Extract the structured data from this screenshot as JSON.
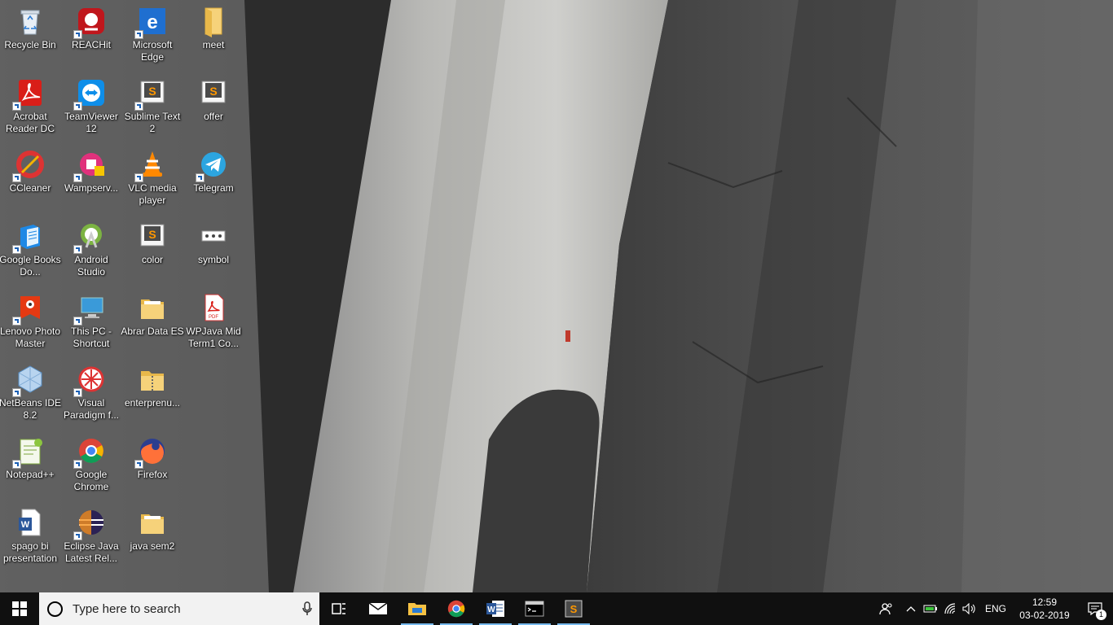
{
  "desktop": {
    "icons": [
      {
        "label": "Recycle Bin",
        "icon": "recycle-bin-icon"
      },
      {
        "label": "REACHit",
        "icon": "reachit-icon"
      },
      {
        "label": "Microsoft Edge",
        "icon": "edge-icon"
      },
      {
        "label": "meet",
        "icon": "folder-icon"
      },
      {
        "label": "Acrobat Reader DC",
        "icon": "acrobat-icon"
      },
      {
        "label": "TeamViewer 12",
        "icon": "teamviewer-icon"
      },
      {
        "label": "Sublime Text 2",
        "icon": "sublime-icon"
      },
      {
        "label": "offer",
        "icon": "sublime-file-icon"
      },
      {
        "label": "CCleaner",
        "icon": "ccleaner-icon"
      },
      {
        "label": "Wampserv...",
        "icon": "wampserver-icon"
      },
      {
        "label": "VLC media player",
        "icon": "vlc-icon"
      },
      {
        "label": "Telegram",
        "icon": "telegram-icon"
      },
      {
        "label": "Google Books Do...",
        "icon": "google-books-icon"
      },
      {
        "label": "Android Studio",
        "icon": "android-studio-icon"
      },
      {
        "label": "color",
        "icon": "sublime-file-icon"
      },
      {
        "label": "symbol",
        "icon": "image-file-icon"
      },
      {
        "label": "Lenovo Photo Master",
        "icon": "lenovo-photo-icon"
      },
      {
        "label": "This PC - Shortcut",
        "icon": "this-pc-icon"
      },
      {
        "label": "Abrar Data ES",
        "icon": "folder-icon"
      },
      {
        "label": "WPJava Mid Term1 Co...",
        "icon": "pdf-icon"
      },
      {
        "label": "NetBeans IDE 8.2",
        "icon": "netbeans-icon"
      },
      {
        "label": "Visual Paradigm f...",
        "icon": "visual-paradigm-icon"
      },
      {
        "label": "enterprenu...",
        "icon": "zip-folder-icon"
      },
      {
        "label": "Notepad++",
        "icon": "notepadpp-icon"
      },
      {
        "label": "Google Chrome",
        "icon": "chrome-icon"
      },
      {
        "label": "Firefox",
        "icon": "firefox-icon"
      },
      {
        "label": "spago bi presentation",
        "icon": "word-doc-icon"
      },
      {
        "label": "Eclipse Java Latest Rel...",
        "icon": "eclipse-icon"
      },
      {
        "label": "java sem2",
        "icon": "folder-icon"
      }
    ]
  },
  "taskbar": {
    "search_placeholder": "Type here to search",
    "language": "ENG",
    "time": "12:59",
    "date": "03-02-2019",
    "notification_count": "1",
    "pinned": [
      {
        "name": "task-view",
        "running": false
      },
      {
        "name": "mail",
        "running": false
      },
      {
        "name": "file-explorer",
        "running": true
      },
      {
        "name": "chrome",
        "running": true
      },
      {
        "name": "word",
        "running": true
      },
      {
        "name": "command-prompt",
        "running": true
      },
      {
        "name": "sublime-text",
        "running": true
      }
    ]
  },
  "colors": {
    "taskbar_bg": "#101010",
    "search_bg": "#f2f2f2",
    "running_indicator": "#76b9ed"
  }
}
